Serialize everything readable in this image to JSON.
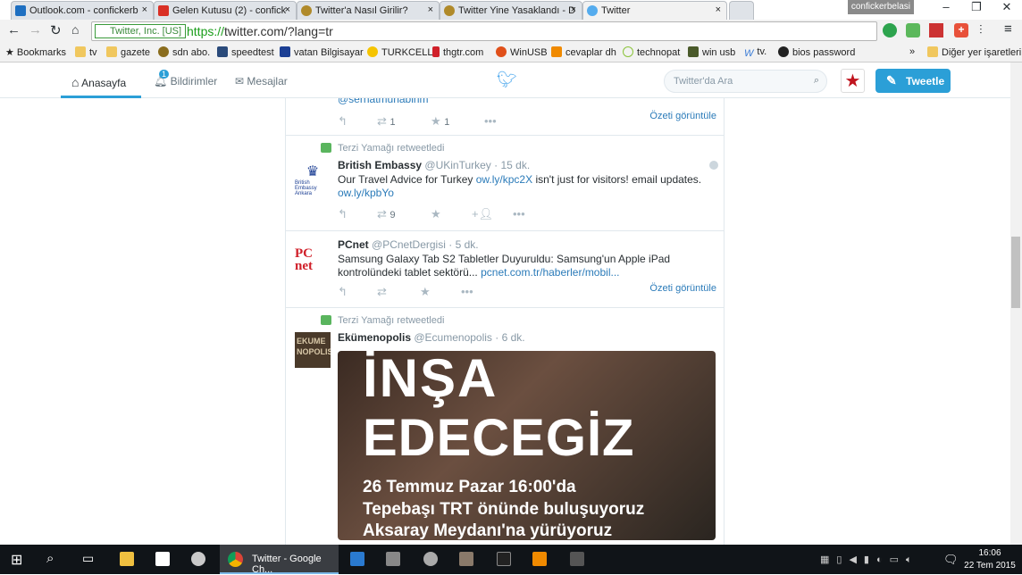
{
  "browser": {
    "tabs": [
      {
        "title": "Outlook.com - confickerb",
        "color": "#1e6fc1"
      },
      {
        "title": "Gelen Kutusu (2) - confick",
        "color": "#d93025"
      },
      {
        "title": "Twitter'a Nasıl Girilir?",
        "color": "#b08a2a"
      },
      {
        "title": "Twitter Yine Yasaklandı - D",
        "color": "#b08a2a"
      },
      {
        "title": "Twitter",
        "color": "#55acee"
      }
    ],
    "user": "confickerbelasi",
    "window": {
      "minimize": "–",
      "maximize": "❐",
      "close": "✕"
    },
    "ev_badge": "Twitter, Inc. [US]",
    "url_scheme": "https://",
    "url_rest": "twitter.com/?lang=tr",
    "bookmarks": [
      "Bookmarks",
      "tv",
      "gazete",
      "sdn abo.",
      "speedtest",
      "vatan Bilgisayar",
      "TURKCELL",
      "thgtr.com",
      "WinUSB",
      "cevaplar dh",
      "technopat",
      "win usb",
      "tv.",
      "bios password"
    ],
    "other_bookmarks": "Diğer yer işaretleri"
  },
  "twitter": {
    "nav": {
      "home": "Anasayfa",
      "notifications": "Bildirimler",
      "notif_count": "1",
      "messages": "Mesajlar"
    },
    "search_placeholder": "Twitter'da Ara",
    "tweet_button": "Tweetle",
    "accent": "#2b9fd7"
  },
  "tweets": [
    {
      "partial_text": "@serhatmunabirim",
      "retweets": "1",
      "favorites": "1",
      "summary": "Özeti görüntüle"
    },
    {
      "context": "Terzi Yamağı retweetledi",
      "name": "British Embassy",
      "handle": "@UKinTurkey",
      "time": "· 15 dk.",
      "text": "Our Travel Advice for Turkey ",
      "link1": "ow.ly/kpc2X",
      "text2": " isn't just for visitors! email updates. ",
      "link2": "ow.ly/kpbYo",
      "retweets": "9",
      "avatar_caption": "British Embassy Ankara"
    },
    {
      "name": "PCnet",
      "handle": "@PCnetDergisi",
      "time": "· 5 dk.",
      "text": "Samsung Galaxy Tab S2 Tabletler Duyuruldu: Samsung'un Apple iPad kontrolündeki tablet sektörü... ",
      "link1": "pcnet.com.tr/haberler/mobil...",
      "summary": "Özeti görüntüle",
      "avatar_logo": "PC net"
    },
    {
      "context": "Terzi Yamağı retweetledi",
      "name": "Ekümenopolis",
      "handle": "@Ecumenopolis",
      "time": "· 6 dk.",
      "avatar_logo": "EKUME NOPOLIS",
      "media": {
        "line1": "İNŞA",
        "line2": "EDECEGİZ",
        "line3": "26 Temmuz Pazar 16:00'da",
        "line4": "Tepebaşı TRT önünde buluşuyoruz",
        "line5": "Aksaray Meydanı'na yürüyoruz"
      }
    }
  ],
  "taskbar": {
    "active_app": "Twitter - Google Ch...",
    "time": "16:06",
    "date": "22 Tem 2015"
  }
}
